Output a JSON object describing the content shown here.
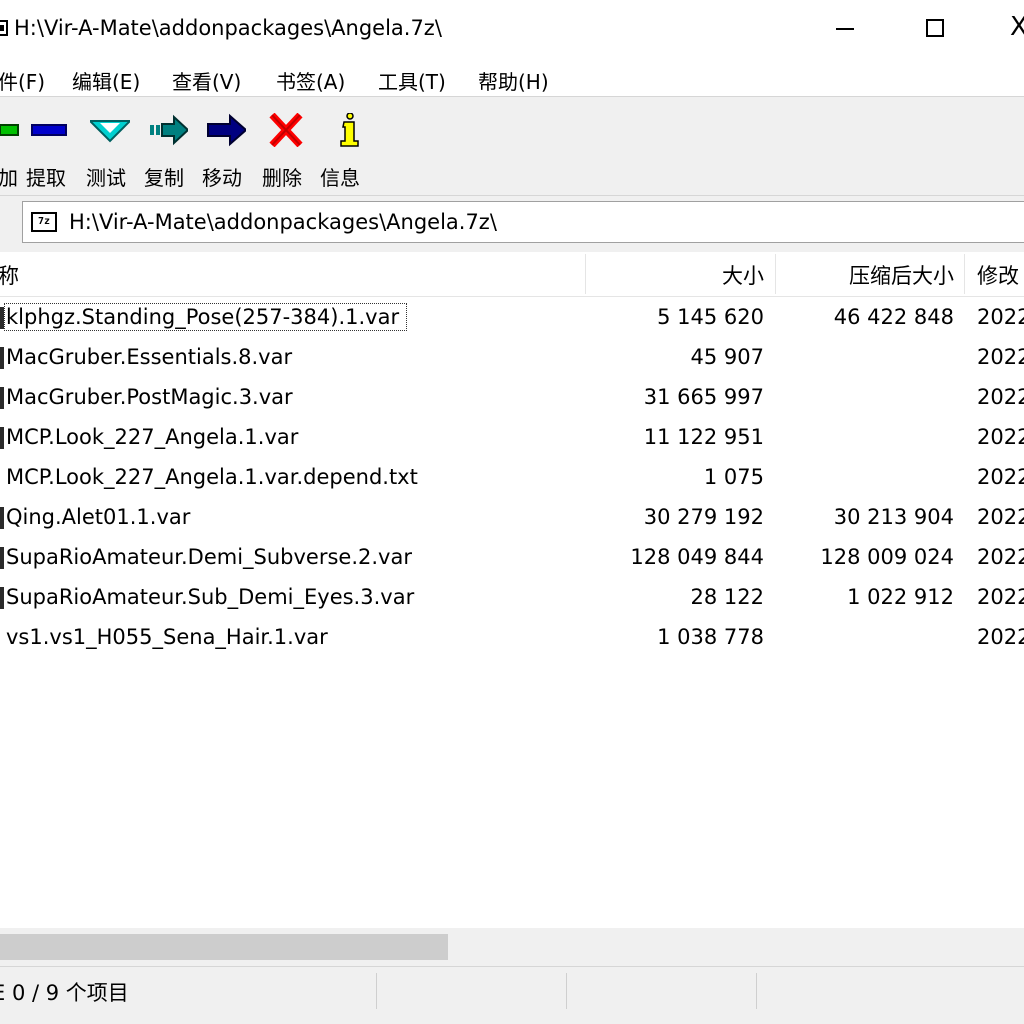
{
  "window": {
    "title": "H:\\Vir-A-Mate\\addonpackages\\Angela.7z\\"
  },
  "window_controls": {
    "minimize": "",
    "maximize": "",
    "close": "X"
  },
  "menu": [
    {
      "label": "件(F)"
    },
    {
      "label": "编辑(E)"
    },
    {
      "label": "查看(V)"
    },
    {
      "label": "书签(A)"
    },
    {
      "label": "工具(T)"
    },
    {
      "label": "帮助(H)"
    }
  ],
  "toolbar": [
    {
      "label": "加",
      "icon": "add-icon",
      "color": "#00c000"
    },
    {
      "label": "提取",
      "icon": "extract-icon",
      "color": "#0000cc"
    },
    {
      "label": "测试",
      "icon": "test-icon",
      "color": "#00c8c8"
    },
    {
      "label": "复制",
      "icon": "copy-icon",
      "color": "#008080"
    },
    {
      "label": "移动",
      "icon": "move-icon",
      "color": "#000080"
    },
    {
      "label": "删除",
      "icon": "delete-icon",
      "color": "#ff0000"
    },
    {
      "label": "信息",
      "icon": "info-icon",
      "color": "#ffff00"
    }
  ],
  "address": {
    "icon_text": "7z",
    "path": "H:\\Vir-A-Mate\\addonpackages\\Angela.7z\\"
  },
  "columns": {
    "name": "称",
    "size": "大小",
    "packed": "压缩后大小",
    "modified": "修改"
  },
  "files": [
    {
      "name": "klphgz.Standing_Pose(257-384).1.var",
      "size": "5 145 620",
      "packed": "46 422 848",
      "modified": "2022"
    },
    {
      "name": "MacGruber.Essentials.8.var",
      "size": "45 907",
      "packed": "",
      "modified": "2022"
    },
    {
      "name": "MacGruber.PostMagic.3.var",
      "size": "31 665 997",
      "packed": "",
      "modified": "2022"
    },
    {
      "name": "MCP.Look_227_Angela.1.var",
      "size": "11 122 951",
      "packed": "",
      "modified": "2022"
    },
    {
      "name": "MCP.Look_227_Angela.1.var.depend.txt",
      "size": "1 075",
      "packed": "",
      "modified": "2022"
    },
    {
      "name": "Qing.Alet01.1.var",
      "size": "30 279 192",
      "packed": "30 213 904",
      "modified": "2022"
    },
    {
      "name": "SupaRioAmateur.Demi_Subverse.2.var",
      "size": "128 049 844",
      "packed": "128 009 024",
      "modified": "2022"
    },
    {
      "name": "SupaRioAmateur.Sub_Demi_Eyes.3.var",
      "size": "28 122",
      "packed": "1 022 912",
      "modified": "2022"
    },
    {
      "name": "vs1.vs1_H055_Sena_Hair.1.var",
      "size": "1 038 778",
      "packed": "",
      "modified": "2022"
    }
  ],
  "status": {
    "text": "E 0 / 9 个项目"
  }
}
